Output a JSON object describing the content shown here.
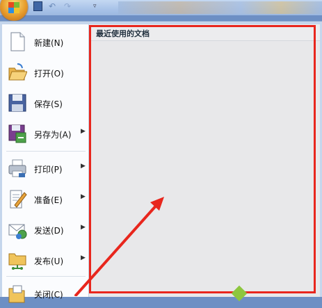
{
  "recent_panel": {
    "title": "最近使用的文档"
  },
  "menu": {
    "items": [
      {
        "label": "新建(N)",
        "icon": "new-document-icon",
        "has_submenu": false
      },
      {
        "label": "打开(O)",
        "icon": "open-folder-icon",
        "has_submenu": false
      },
      {
        "label": "保存(S)",
        "icon": "save-disk-icon",
        "has_submenu": false
      },
      {
        "label": "另存为(A)",
        "icon": "save-as-icon",
        "has_submenu": true
      },
      {
        "label": "打印(P)",
        "icon": "printer-icon",
        "has_submenu": true
      },
      {
        "label": "准备(E)",
        "icon": "prepare-document-icon",
        "has_submenu": true
      },
      {
        "label": "发送(D)",
        "icon": "send-mail-icon",
        "has_submenu": true
      },
      {
        "label": "发布(U)",
        "icon": "publish-folder-icon",
        "has_submenu": true
      },
      {
        "label": "关闭(C)",
        "icon": "close-folder-icon",
        "has_submenu": false
      }
    ]
  },
  "colors": {
    "annotation_red": "#e8261d",
    "menu_background": "#c5d6ec",
    "recent_background": "#e8e8ea"
  }
}
